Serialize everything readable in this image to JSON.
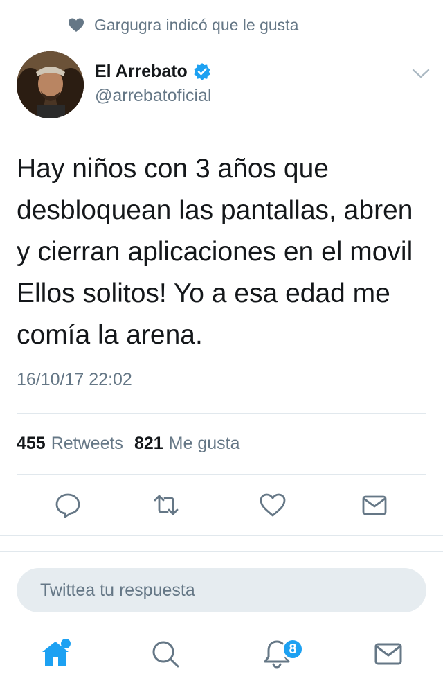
{
  "context": {
    "liked_by_text": "Gargugra indicó que le gusta",
    "icon": "heart-icon"
  },
  "author": {
    "display_name": "El Arrebato",
    "handle": "@arrebatoficial",
    "verified": true,
    "verified_icon": "verified-badge-icon"
  },
  "tweet": {
    "lines": [
      "Hay niños con 3 años que",
      "desbloquean las pantallas, abren",
      "y cierran aplicaciones en el movil",
      "Ellos solitos! Yo a esa edad me",
      "comía la arena."
    ],
    "timestamp": "16/10/17 22:02"
  },
  "stats": {
    "retweets_count": "455",
    "retweets_label": "Retweets",
    "likes_count": "821",
    "likes_label": "Me gusta"
  },
  "actions": [
    {
      "name": "reply",
      "icon": "reply-icon"
    },
    {
      "name": "retweet",
      "icon": "retweet-icon"
    },
    {
      "name": "like",
      "icon": "heart-icon"
    },
    {
      "name": "direct-message",
      "icon": "mail-icon"
    }
  ],
  "reply": {
    "placeholder": "Twittea tu respuesta"
  },
  "tabbar": {
    "tabs": [
      {
        "name": "home",
        "icon": "home-icon",
        "active": true
      },
      {
        "name": "search",
        "icon": "search-icon"
      },
      {
        "name": "notifications",
        "icon": "bell-icon"
      },
      {
        "name": "messages",
        "icon": "mail-icon"
      }
    ],
    "notifications_badge": "8"
  },
  "colors": {
    "accent": "#1da1f2",
    "text_primary": "#14171a",
    "text_secondary": "#657786",
    "divider": "#e1e8ed",
    "reply_box_bg": "#e6ecf0"
  }
}
